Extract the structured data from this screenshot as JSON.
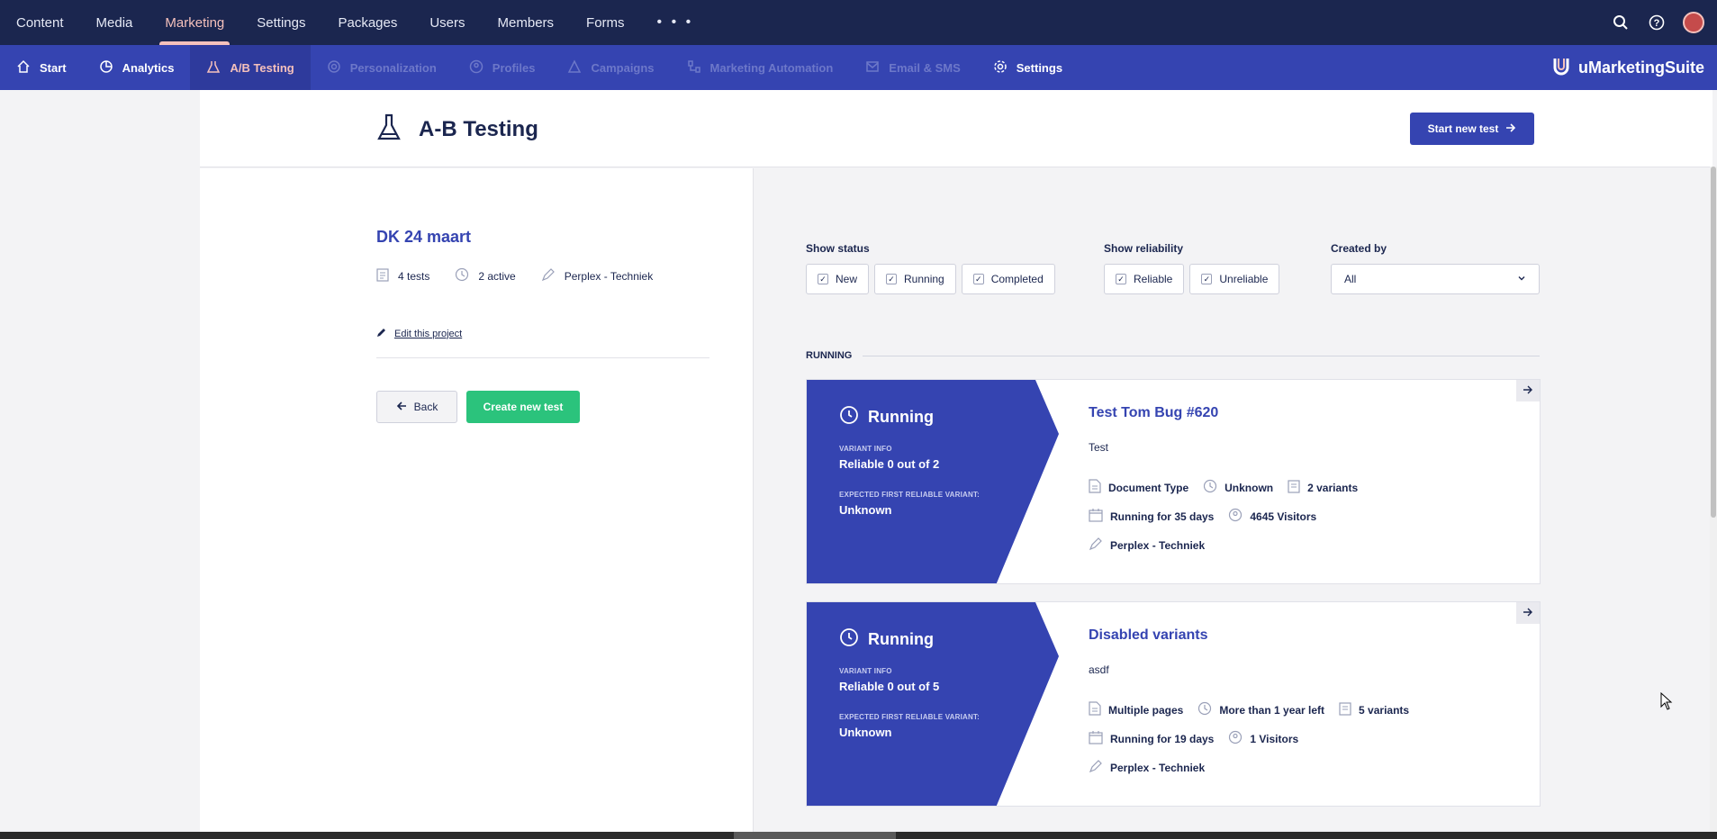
{
  "topnav": {
    "items": [
      {
        "label": "Content"
      },
      {
        "label": "Media"
      },
      {
        "label": "Marketing"
      },
      {
        "label": "Settings"
      },
      {
        "label": "Packages"
      },
      {
        "label": "Users"
      },
      {
        "label": "Members"
      },
      {
        "label": "Forms"
      }
    ],
    "more_label": "• • •",
    "active_index": 2,
    "active_color": "#f5c1bc",
    "bg_color": "#1b264f"
  },
  "subnav": {
    "items": [
      {
        "label": "Start",
        "icon": "home-icon"
      },
      {
        "label": "Analytics",
        "icon": "pie-chart-icon"
      },
      {
        "label": "A/B Testing",
        "icon": "flask-icon"
      },
      {
        "label": "Personalization",
        "icon": "target-icon"
      },
      {
        "label": "Profiles",
        "icon": "user-circle-icon"
      },
      {
        "label": "Campaigns",
        "icon": "campaign-icon"
      },
      {
        "label": "Marketing Automation",
        "icon": "automation-icon"
      },
      {
        "label": "Email & SMS",
        "icon": "email-icon"
      },
      {
        "label": "Settings",
        "icon": "gear-icon"
      }
    ],
    "brand": "uMarketingSuite",
    "bg_color": "#3544b1"
  },
  "header": {
    "title": "A-B Testing",
    "start_button": "Start new test"
  },
  "project": {
    "title": "DK 24 maart",
    "tests": "4 tests",
    "active": "2 active",
    "owner": "Perplex - Techniek",
    "edit_link": "Edit this project",
    "back_button": "Back",
    "create_button": "Create new test"
  },
  "filters": {
    "status_label": "Show status",
    "status_options": [
      "New",
      "Running",
      "Completed"
    ],
    "reliability_label": "Show reliability",
    "reliability_options": [
      "Reliable",
      "Unreliable"
    ],
    "created_label": "Created by",
    "created_value": "All"
  },
  "section": {
    "label": "RUNNING"
  },
  "cards": [
    {
      "status": "Running",
      "variant_info_label": "VARIANT INFO",
      "variant_info": "Reliable 0 out of 2",
      "expected_label": "EXPECTED FIRST RELIABLE VARIANT:",
      "expected": "Unknown",
      "title": "Test Tom Bug #620",
      "description": "Test",
      "type": "Document Type",
      "time_left": "Unknown",
      "variants": "2 variants",
      "running_for": "Running for 35 days",
      "visitors": "4645 Visitors",
      "owner": "Perplex - Techniek"
    },
    {
      "status": "Running",
      "variant_info_label": "VARIANT INFO",
      "variant_info": "Reliable 0 out of 5",
      "expected_label": "EXPECTED FIRST RELIABLE VARIANT:",
      "expected": "Unknown",
      "title": "Disabled variants",
      "description": "asdf",
      "type": "Multiple pages",
      "time_left": "More than 1 year left",
      "variants": "5 variants",
      "running_for": "Running for 19 days",
      "visitors": "1 Visitors",
      "owner": "Perplex - Techniek"
    }
  ],
  "colors": {
    "accent": "#3544b1",
    "success": "#2bc37c",
    "dark": "#1b264f"
  }
}
